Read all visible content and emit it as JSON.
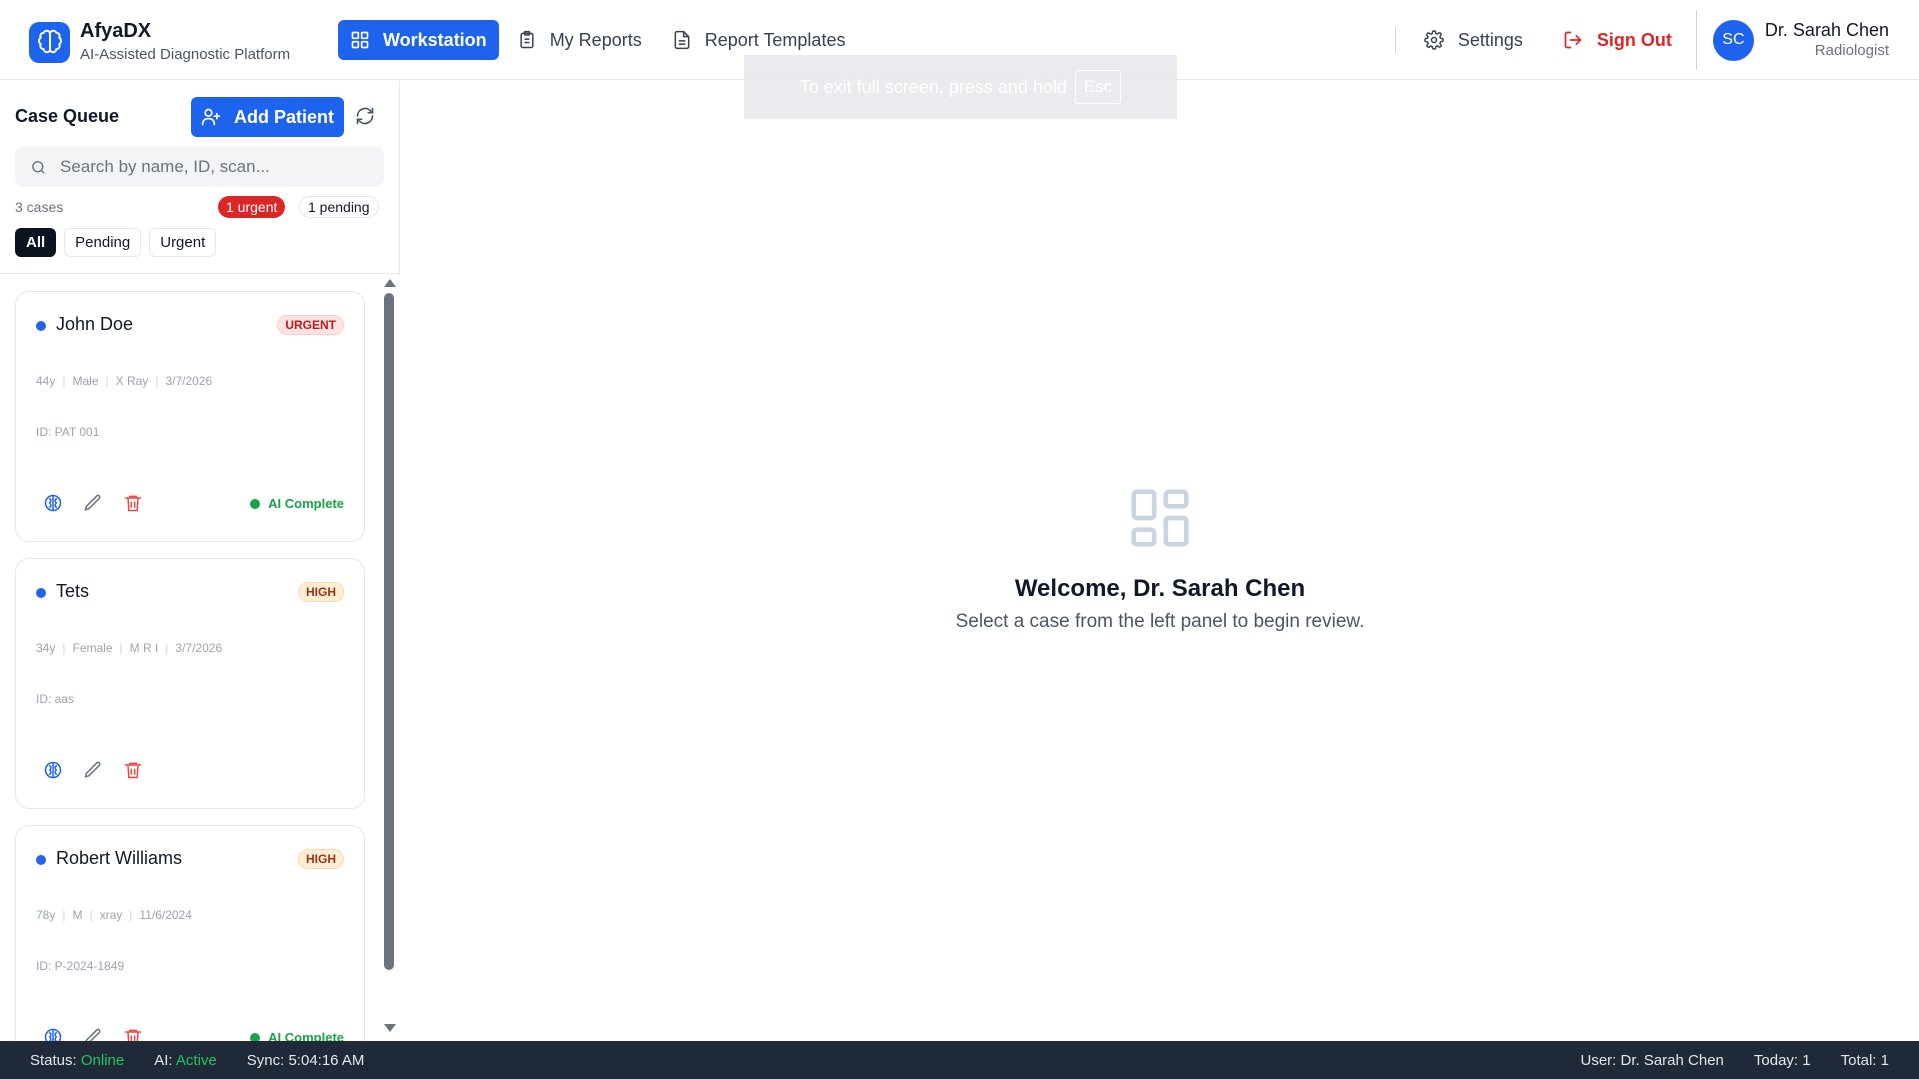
{
  "brand": {
    "name": "AfyaDX",
    "subtitle": "AI-Assisted Diagnostic Platform"
  },
  "nav": {
    "workstation": "Workstation",
    "my_reports": "My Reports",
    "report_templates": "Report Templates"
  },
  "header": {
    "settings": "Settings",
    "sign_out": "Sign Out",
    "user_initials": "SC",
    "user_name": "Dr. Sarah Chen",
    "user_role": "Radiologist"
  },
  "fullscreen_toast": {
    "text": "To exit full screen, press and hold",
    "key": "Esc"
  },
  "sidebar": {
    "title": "Case Queue",
    "add_patient": "Add Patient",
    "search_placeholder": "Search by name, ID, scan...",
    "case_count": "3 cases",
    "urgent_badge": "1 urgent",
    "pending_badge": "1 pending",
    "filters": [
      "All",
      "Pending",
      "Urgent"
    ],
    "active_filter": "All"
  },
  "cases": [
    {
      "name": "John Doe",
      "priority": "URGENT",
      "age": "44y",
      "sex": "Male",
      "scan": "X Ray",
      "date": "3/7/2026",
      "id": "ID: PAT 001",
      "ai_status": "AI Complete"
    },
    {
      "name": "Tets",
      "priority": "HIGH",
      "age": "34y",
      "sex": "Female",
      "scan": "M R I",
      "date": "3/7/2026",
      "id": "ID: aas",
      "ai_status": ""
    },
    {
      "name": "Robert Williams",
      "priority": "HIGH",
      "age": "78y",
      "sex": "M",
      "scan": "xray",
      "date": "11/6/2024",
      "id": "ID: P-2024-1849",
      "ai_status": "AI Complete"
    }
  ],
  "main": {
    "welcome_title": "Welcome, Dr. Sarah Chen",
    "welcome_subtitle": "Select a case from the left panel to begin review."
  },
  "statusbar": {
    "status_label": "Status:",
    "status_value": "Online",
    "ai_label": "AI:",
    "ai_value": "Active",
    "sync": "Sync: 5:04:16 AM",
    "user": "User: Dr. Sarah Chen",
    "today": "Today: 1",
    "total": "Total: 1"
  },
  "colors": {
    "accent": "#1d63ed",
    "danger": "#dc2626",
    "success": "#16a34a",
    "statusbar": "#1f2937"
  }
}
